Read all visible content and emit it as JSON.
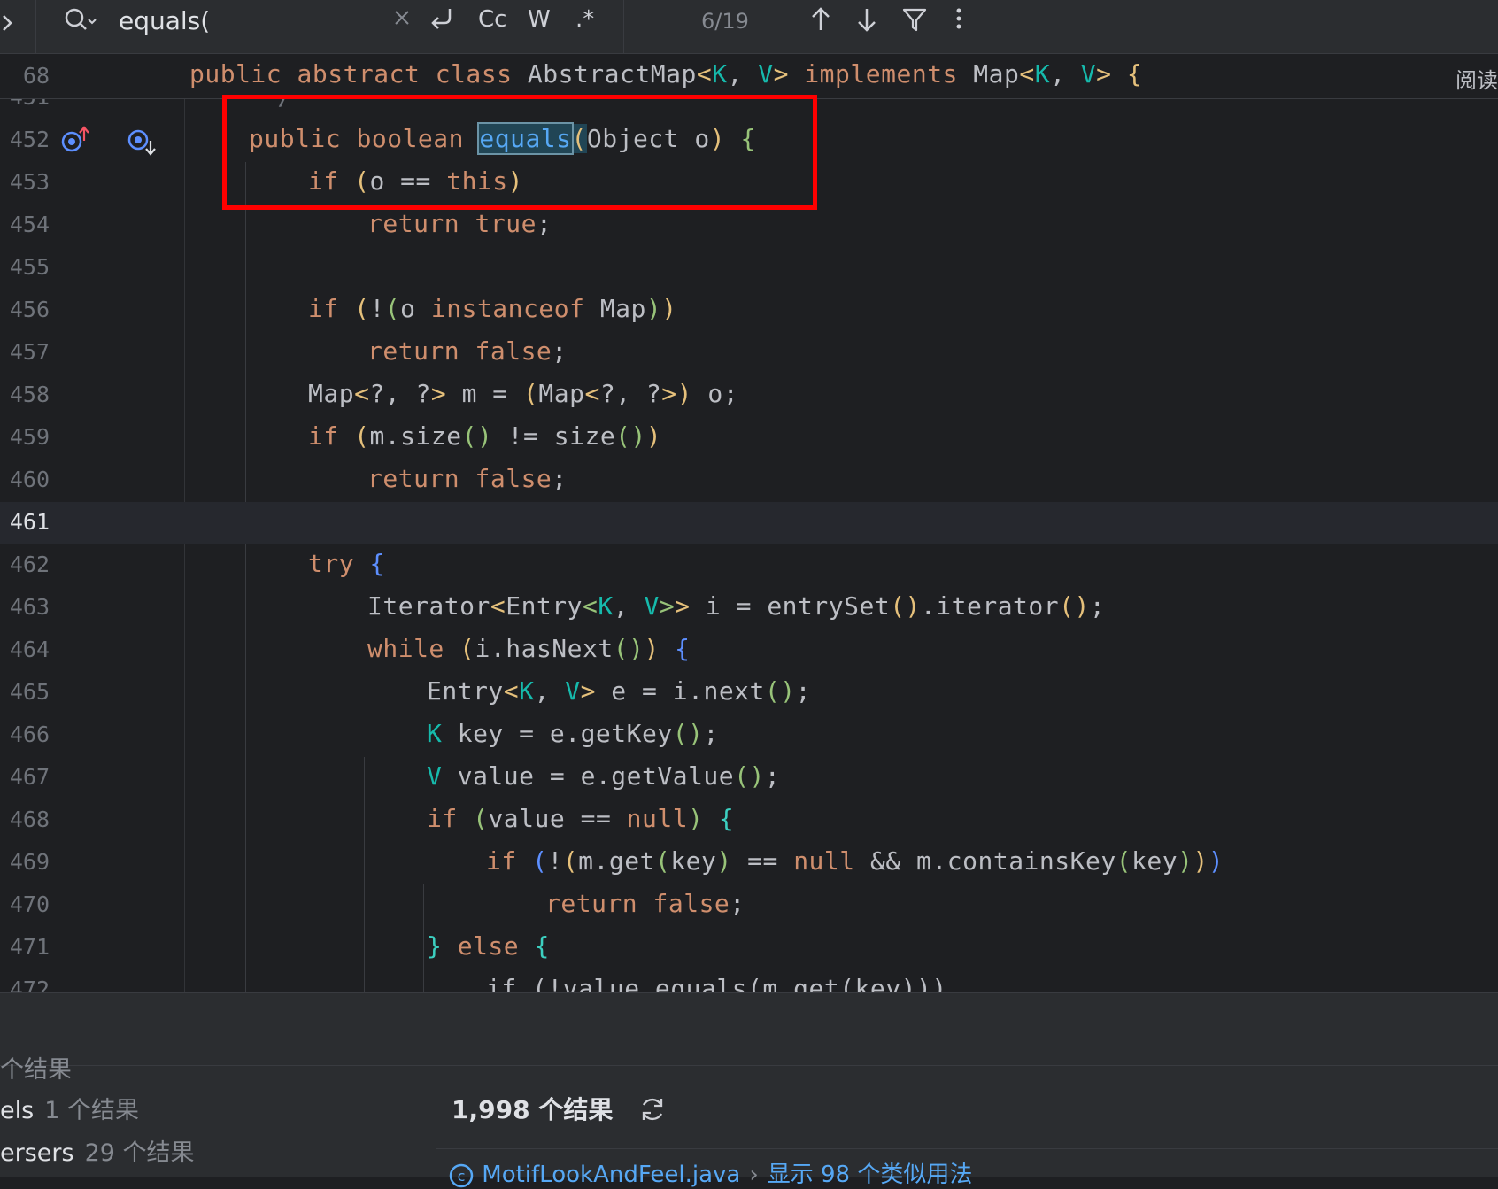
{
  "search": {
    "query": "equals(",
    "match_counter": "6/19",
    "option_case": "Cc",
    "option_words": "W",
    "option_regex": ".*"
  },
  "sticky_header": {
    "line_number": "68",
    "code": "public abstract class AbstractMap<K, V> implements Map<K, V> {"
  },
  "reader_mode_label": "阅读",
  "editor": {
    "partial_top_line": {
      "number": "451",
      "text": "*/"
    },
    "partial_bottom_line": {
      "number": "472",
      "text": "if (!value.equals(m.get(key)))"
    },
    "line_numbers": [
      "452",
      "453",
      "454",
      "455",
      "456",
      "457",
      "458",
      "459",
      "460",
      "461",
      "462",
      "463",
      "464",
      "465",
      "466",
      "467",
      "468",
      "469",
      "470",
      "471"
    ],
    "current_line": "461"
  },
  "colors": {
    "keyword": "#cf8e6d",
    "method": "#56a8f5",
    "type_param": "#16baac",
    "annotation_box": "#ff0000",
    "background": "#1e1f22"
  },
  "icons": {
    "gutter_override": "implementing-method-override-icon",
    "gutter_down": "overridden-method-down-icon"
  },
  "bottom_panel": {
    "header_partial": "个结果",
    "left_results": [
      {
        "name": "els",
        "count": "1 个结果"
      },
      {
        "name": "ersers",
        "count": "29 个结果"
      }
    ],
    "total": "1,998 个结果",
    "usage_file": "MotifLookAndFeel.java",
    "usage_more": "显示 98 个类似用法"
  }
}
